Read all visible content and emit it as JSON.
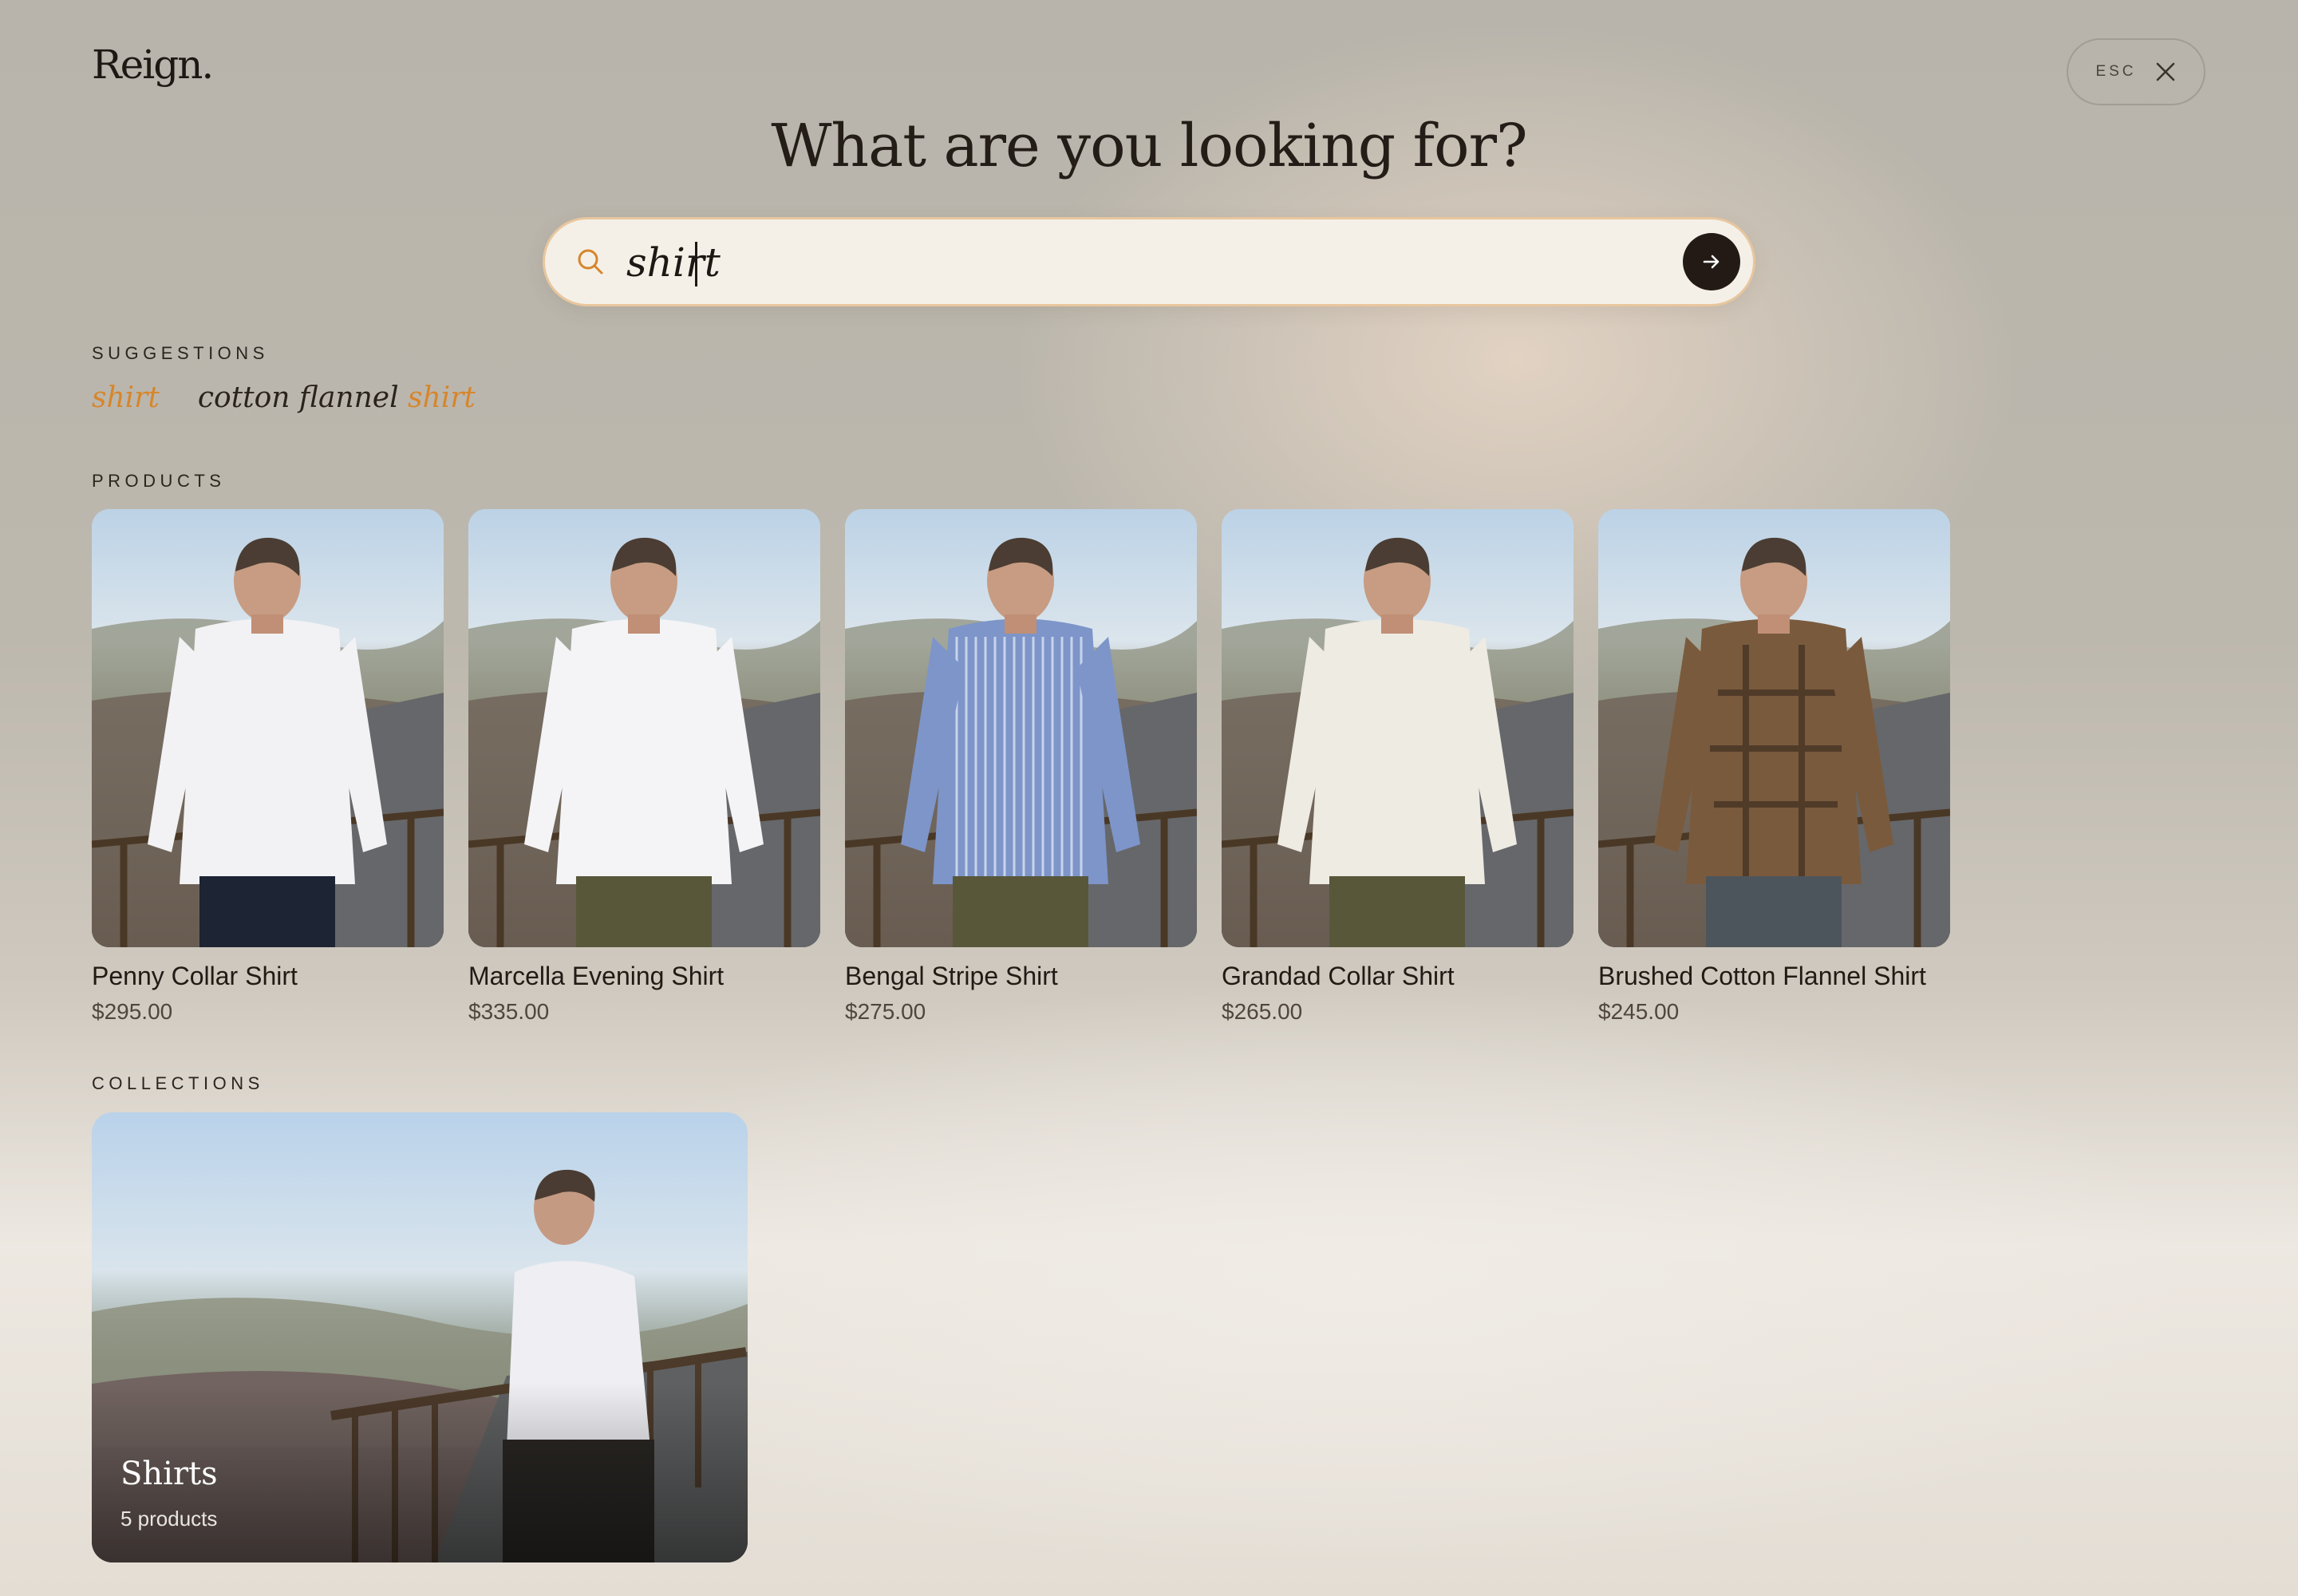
{
  "header": {
    "logo": "Reign.",
    "esc_label": "ESC",
    "title": "What are you looking for?"
  },
  "search": {
    "value": "shirt",
    "placeholder": "",
    "search_icon": "search-icon",
    "submit_icon": "arrow-right-icon"
  },
  "suggestions": {
    "label": "SUGGESTIONS",
    "items": [
      {
        "prefix": "",
        "match": "shirt"
      },
      {
        "prefix": "cotton flannel ",
        "match": "shirt"
      }
    ]
  },
  "products": {
    "label": "PRODUCTS",
    "items": [
      {
        "name": "Penny Collar Shirt",
        "price": "$295.00",
        "shirt_color": "#f2f2f4"
      },
      {
        "name": "Marcella Evening Shirt",
        "price": "$335.00",
        "shirt_color": "#f4f4f6"
      },
      {
        "name": "Bengal Stripe Shirt",
        "price": "$275.00",
        "shirt_color": "#7d95c9"
      },
      {
        "name": "Grandad Collar Shirt",
        "price": "$265.00",
        "shirt_color": "#eeebe3"
      },
      {
        "name": "Brushed Cotton Flannel Shirt",
        "price": "$245.00",
        "shirt_color": "#7a5a3c"
      }
    ]
  },
  "collections": {
    "label": "COLLECTIONS",
    "items": [
      {
        "title": "Shirts",
        "count": "5 products"
      }
    ]
  },
  "colors": {
    "accent": "#d6862b",
    "search_border": "#e8c69e",
    "submit_bg": "#231a15"
  }
}
